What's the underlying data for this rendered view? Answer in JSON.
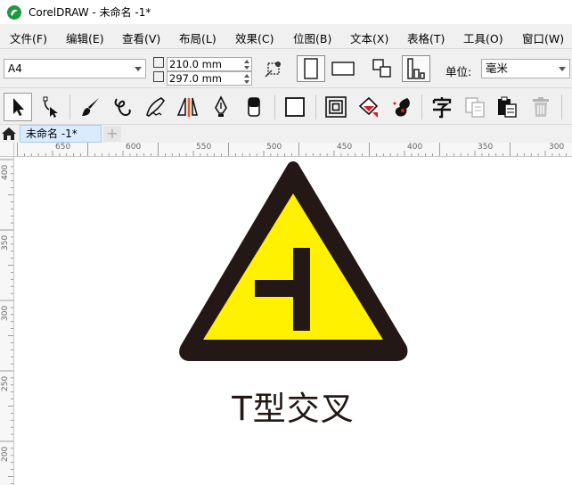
{
  "window": {
    "title": "CorelDRAW - 未命名 -1*"
  },
  "menu": {
    "items": [
      "文件(F)",
      "编辑(E)",
      "查看(V)",
      "布局(L)",
      "效果(C)",
      "位图(B)",
      "文本(X)",
      "表格(T)",
      "工具(O)",
      "窗口(W)"
    ]
  },
  "propbar": {
    "page_size": "A4",
    "width_value": "210.0 mm",
    "height_value": "297.0 mm",
    "unit_label": "单位:",
    "unit_value": "毫米"
  },
  "toolbox": {
    "tools": [
      "pick-tool",
      "shape-tool",
      "artistic-media-tool",
      "freehand-tool",
      "calligraphy-tool",
      "dimension-tool",
      "pen-tool",
      "eraser-tool",
      "rectangle-tool",
      "contour-tool",
      "interactive-fill-tool",
      "smear-tool",
      "text-tool",
      "copy-properties-tool",
      "paste-tool",
      "delete-tool"
    ]
  },
  "tabs": {
    "document_tab": "未命名 -1*",
    "add_tab": "+"
  },
  "rulers": {
    "horizontal_labels": [
      "650",
      "600",
      "550",
      "500",
      "450",
      "400",
      "350",
      "300"
    ],
    "vertical_labels": [
      "400",
      "350",
      "300",
      "250",
      "200"
    ]
  },
  "canvas": {
    "sign_text": "T型交叉",
    "colors": {
      "sign_fill": "#fff100",
      "sign_border": "#231815",
      "symbol": "#231815"
    },
    "icon": "t-junction-warning-sign"
  }
}
